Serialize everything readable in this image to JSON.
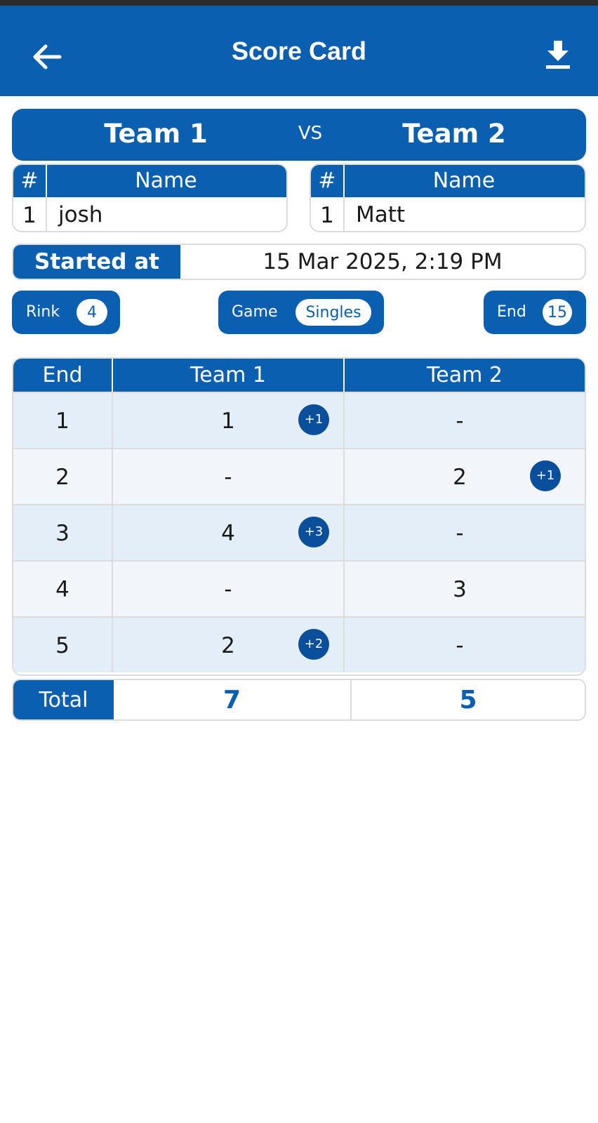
{
  "app_bar": {
    "title": "Score Card",
    "back_icon": "arrow-left-icon",
    "download_icon": "download-icon"
  },
  "matchup": {
    "team1": "Team 1",
    "vs": "VS",
    "team2": "Team 2"
  },
  "rosters": {
    "headers": {
      "number": "#",
      "name": "Name"
    },
    "team1": [
      {
        "number": "1",
        "name": "josh"
      }
    ],
    "team2": [
      {
        "number": "1",
        "name": "Matt"
      }
    ]
  },
  "started": {
    "label": "Started at",
    "value": "15 Mar 2025, 2:19 PM"
  },
  "info_pills": {
    "rink": {
      "label": "Rink",
      "value": "4"
    },
    "game": {
      "label": "Game",
      "value": "Singles"
    },
    "end": {
      "label": "End",
      "value": "15"
    }
  },
  "scores": {
    "headers": {
      "end": "End",
      "team1": "Team 1",
      "team2": "Team 2"
    },
    "rows": [
      {
        "end": "1",
        "team1": "1",
        "team1_badge": "+1",
        "team2": "-",
        "team2_badge": ""
      },
      {
        "end": "2",
        "team1": "-",
        "team1_badge": "",
        "team2": "2",
        "team2_badge": "+1"
      },
      {
        "end": "3",
        "team1": "4",
        "team1_badge": "+3",
        "team2": "-",
        "team2_badge": ""
      },
      {
        "end": "4",
        "team1": "-",
        "team1_badge": "",
        "team2": "3",
        "team2_badge": ""
      },
      {
        "end": "5",
        "team1": "2",
        "team1_badge": "+2",
        "team2": "-",
        "team2_badge": ""
      }
    ],
    "total": {
      "label": "Total",
      "team1": "7",
      "team2": "5"
    }
  },
  "colors": {
    "primary": "#0a5fb0",
    "badge": "#0a4f9c",
    "row_odd": "#e3eef8",
    "row_even": "#f2f5fa",
    "border": "#dcdcdc"
  }
}
